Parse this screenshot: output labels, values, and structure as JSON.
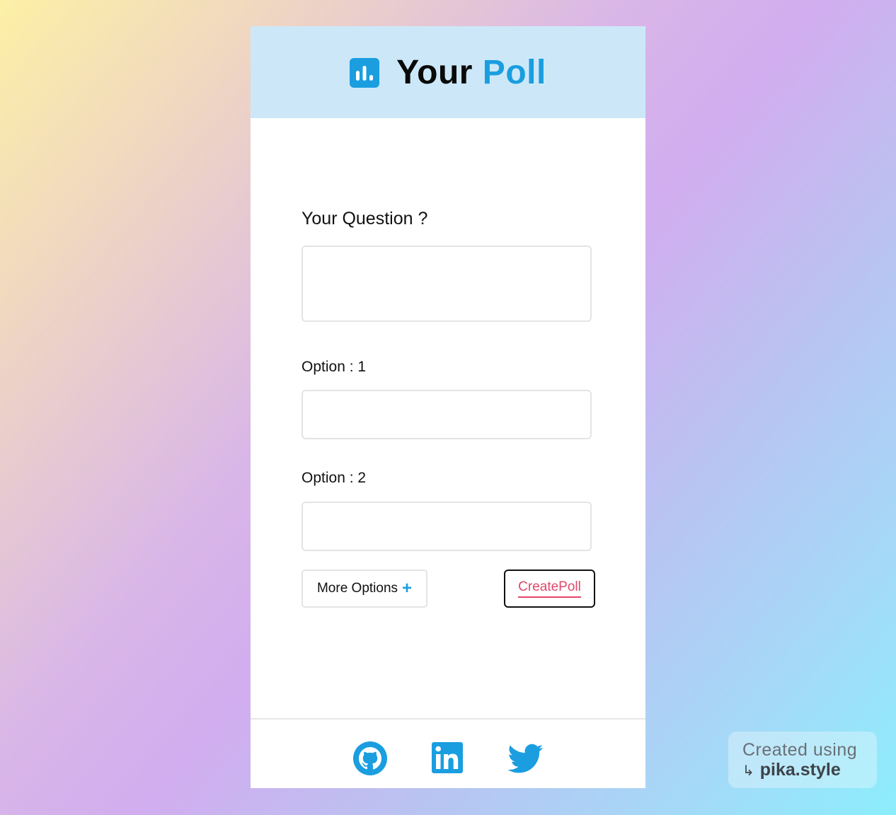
{
  "header": {
    "title_part1": "Your",
    "title_part2": "Poll"
  },
  "form": {
    "question_label": "Your Question ?",
    "question_value": "",
    "options": [
      {
        "label": "Option : 1",
        "value": ""
      },
      {
        "label": "Option : 2",
        "value": ""
      }
    ],
    "more_options_label": "More Options",
    "create_label": "CreatePoll"
  },
  "footer": {
    "icons": [
      "github-icon",
      "linkedin-icon",
      "twitter-icon"
    ]
  },
  "watermark": {
    "line1": "Created using",
    "line2": "pika.style"
  },
  "colors": {
    "accent": "#1a9ee0",
    "create_text": "#e0486a",
    "header_bg": "#cce8f8"
  }
}
